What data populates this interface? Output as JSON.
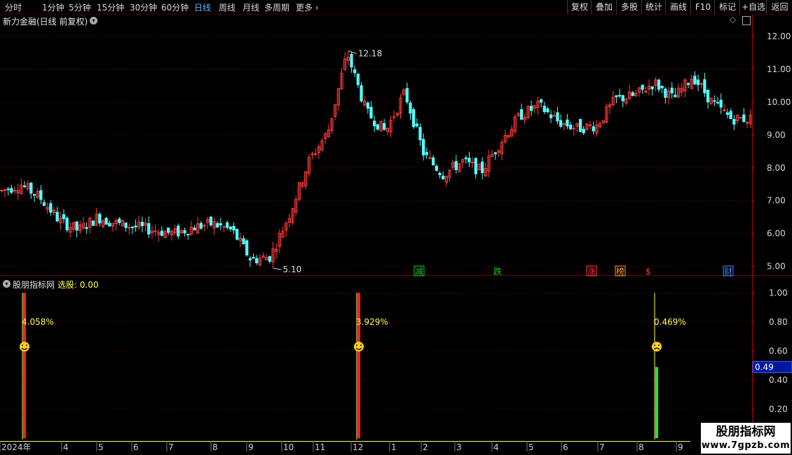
{
  "toolbar": {
    "periods": [
      "分时",
      "1分钟",
      "5分钟",
      "15分钟",
      "30分钟",
      "60分钟",
      "日线",
      "周线",
      "月线",
      "多周期",
      "更多"
    ],
    "active_period": "日线",
    "buttons": [
      "复权",
      "叠加",
      "多股",
      "统计",
      "画线",
      "F10",
      "标记",
      "+自选",
      "返回"
    ]
  },
  "main_chart": {
    "title": "新力金融(日线 前复权)",
    "high_label": "12.18",
    "low_label": "5.10",
    "event_markers": [
      {
        "label": "减",
        "color": "#1ec81e",
        "box": true
      },
      {
        "label": "跌",
        "color": "#1ec81e",
        "box": false
      },
      {
        "label": "涨",
        "color": "#ff3c3c",
        "box": true
      },
      {
        "label": "榜",
        "color": "#ff9a2e",
        "box": true
      },
      {
        "label": "$",
        "color": "#ff3c3c",
        "box": false
      },
      {
        "label": "财",
        "color": "#3c8cff",
        "box": true
      }
    ]
  },
  "sub_chart": {
    "title": "股朋指标网",
    "value_label": "选股: 0.00",
    "current_value_tag": "0.49",
    "signals": [
      {
        "pct": "4.058%",
        "face": "smile",
        "color": "#ff1e1e"
      },
      {
        "pct": "3.929%",
        "face": "smile",
        "color": "#ff1e1e"
      },
      {
        "pct": "0.469%",
        "face": "sad",
        "color": "#22e622"
      }
    ]
  },
  "colors": {
    "up": "#ff3c3c",
    "down": "#54ffff",
    "grid": "#7a0000",
    "axis": "#b00000",
    "accent": "#5fb4ff"
  },
  "chart_data": [
    {
      "type": "candlestick",
      "title": "新力金融(日线 前复权)",
      "ylim": [
        4.8,
        12.3
      ],
      "yticks": [
        5,
        6,
        7,
        8,
        9,
        10,
        11,
        12
      ],
      "x": [
        "2024年",
        "4",
        "5",
        "6",
        "7",
        "8",
        "9",
        "10",
        "11",
        "12",
        "1",
        "2",
        "3",
        "4",
        "5",
        "6",
        "7",
        "8",
        "9"
      ],
      "close": [
        7.3,
        7.5,
        7.1,
        6.4,
        6.1,
        6.5,
        6.3,
        6.2,
        6.1,
        6.0,
        6.2,
        6.3,
        6.1,
        5.2,
        5.3,
        6.6,
        8.2,
        9.1,
        11.5,
        9.7,
        9.1,
        10.3,
        8.4,
        7.8,
        8.2,
        7.9,
        8.8,
        9.6,
        9.9,
        9.4,
        9.2,
        9.3,
        10.1,
        10.2,
        10.6,
        10.1,
        10.8,
        10.0,
        9.5,
        9.5
      ]
    },
    {
      "type": "bar",
      "title": "股朋指标网",
      "ylim": [
        0,
        1.05
      ],
      "yticks": [
        0.2,
        0.4,
        0.6,
        0.8,
        1.0
      ],
      "signals": [
        {
          "x": "2024年",
          "value": 1.0,
          "pct": "4.058%"
        },
        {
          "x": "12",
          "value": 1.0,
          "pct": "3.929%"
        },
        {
          "x": "8",
          "value": 0.49,
          "pct": "0.469%"
        }
      ]
    }
  ]
}
